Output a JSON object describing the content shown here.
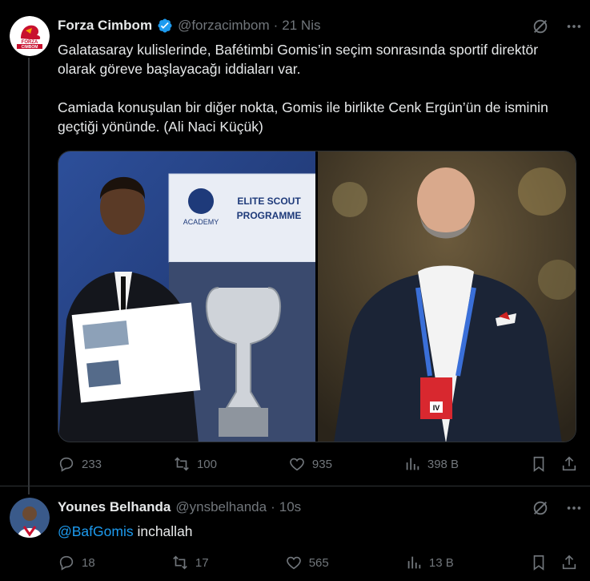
{
  "tweet1": {
    "name": "Forza Cimbom",
    "handle": "@forzacimbom",
    "dot": "·",
    "time": "21 Nis",
    "avatar_text": "FORZA CIMBOM",
    "paragraph1": "Galatasaray kulislerinde, Bafétimbi Gomis’in seçim sonrasında sportif direktör olarak göreve başlayacağı iddiaları var.",
    "paragraph2": "Camiada konuşulan bir diğer nokta, Gomis ile birlikte Cenk Ergün’ün de isminin geçtiği yönünde. (Ali Naci Küçük)",
    "image_left_sign": "ELITE SCOUT PROGRAMME",
    "image_left_academy": "ACADEMY",
    "image_right_badge": "IV",
    "replies": "233",
    "retweets": "100",
    "likes": "935",
    "views": "398 B"
  },
  "tweet2": {
    "name": "Younes Belhanda",
    "handle": "@ynsbelhanda",
    "dot": "·",
    "time": "10s",
    "mention": "@BafGomis",
    "text": " inchallah",
    "replies": "18",
    "retweets": "17",
    "likes": "565",
    "views": "13 B"
  },
  "colors": {
    "background": "#000000",
    "text": "#e7e9ea",
    "muted": "#71767b",
    "accent": "#1d9bf0",
    "verified_gold": "#d4a017",
    "galatasaray_red": "#a90432"
  },
  "icons": [
    "verified-icon",
    "grok-icon",
    "more-icon",
    "reply-icon",
    "retweet-icon",
    "like-icon",
    "views-icon",
    "bookmark-icon",
    "share-icon"
  ]
}
